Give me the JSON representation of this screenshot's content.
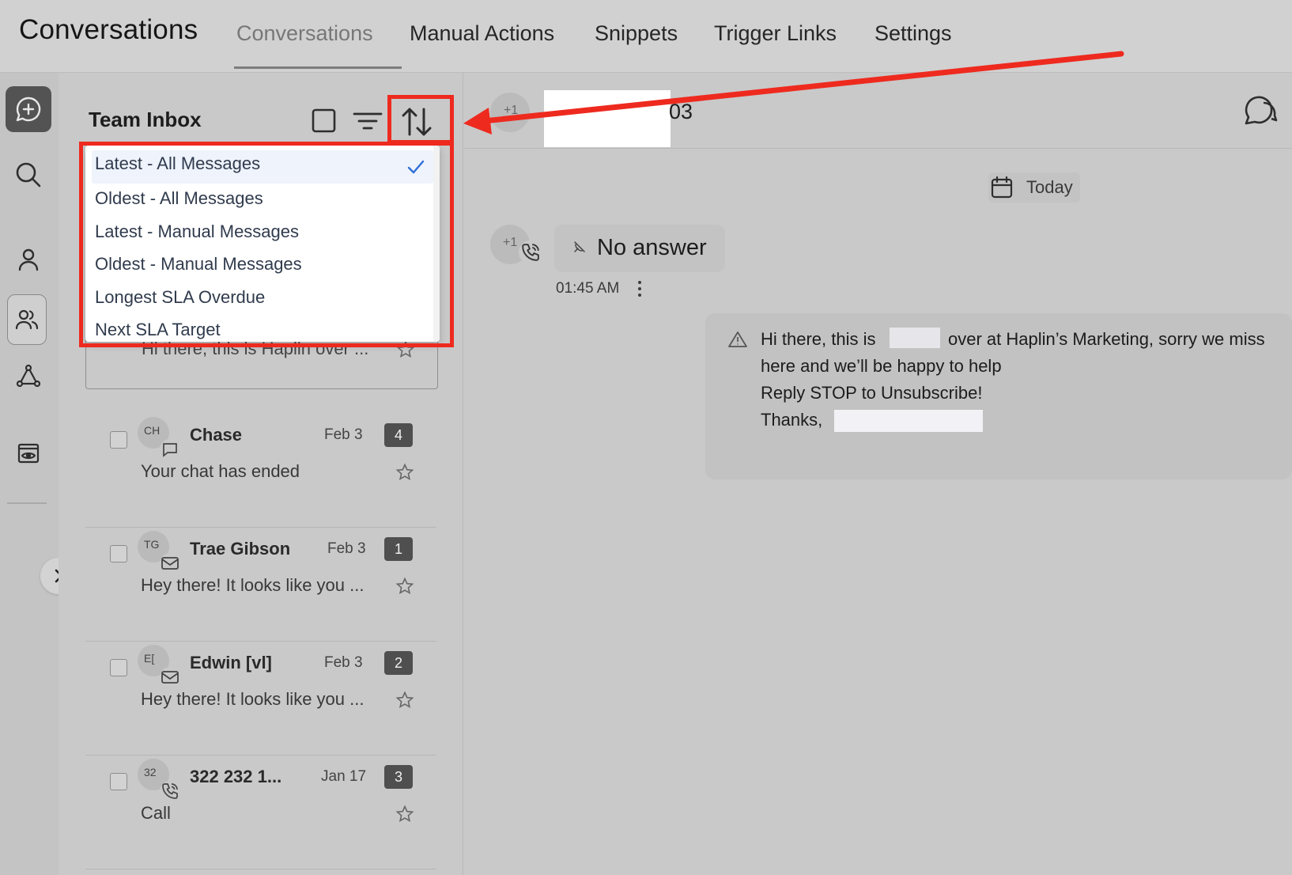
{
  "header": {
    "app_title": "Conversations",
    "tabs": [
      {
        "label": "Conversations",
        "active": true
      },
      {
        "label": "Manual Actions"
      },
      {
        "label": "Snippets"
      },
      {
        "label": "Trigger Links"
      },
      {
        "label": "Settings"
      }
    ]
  },
  "rail": {
    "icons": [
      "chat-plus-icon",
      "search-icon",
      "contact-icon",
      "team-icon",
      "network-icon",
      "preview-icon"
    ],
    "expand_icon": "chevron-right-icon"
  },
  "inbox": {
    "title": "Team Inbox",
    "sort_menu": {
      "options": [
        "Latest - All Messages",
        "Oldest - All Messages",
        "Latest - Manual Messages",
        "Oldest - Manual Messages",
        "Longest SLA Overdue",
        "Next SLA Target"
      ],
      "selected_index": 0
    },
    "partial_preview": "Hi there, this is Haplin over ...",
    "conversations": [
      {
        "initials": "CH",
        "name": "Chase",
        "date": "Feb 3",
        "count": "4",
        "preview": "Your chat has ended",
        "channel": "chat-icon"
      },
      {
        "initials": "TG",
        "name": "Trae Gibson",
        "date": "Feb 3",
        "count": "1",
        "preview": "Hey there!  It looks like you ...",
        "channel": "mail-icon"
      },
      {
        "initials": "E[",
        "name": "Edwin [vl]",
        "date": "Feb 3",
        "count": "2",
        "preview": "Hey there!  It looks like you ...",
        "channel": "mail-icon"
      },
      {
        "initials": "32",
        "name": "322 232 1...",
        "date": "Jan 17",
        "count": "3",
        "preview": "Call",
        "channel": "phone-icon"
      }
    ]
  },
  "chat": {
    "contact_initials": "+1",
    "phone_suffix": "03",
    "date_divider": "Today",
    "call": {
      "initials": "+1",
      "status": "No answer",
      "time": "01:45 AM"
    },
    "message_lines": [
      "Hi there, this is",
      "over at Haplin’s Marketing, sorry we miss",
      "here and we’ll be happy to help",
      "Reply STOP to Unsubscribe!",
      "Thanks,"
    ]
  },
  "colors": {
    "annotation_red": "#ee2a1f",
    "selected_blue": "#2f6fd8",
    "badge_dark": "#4f4f4f"
  }
}
